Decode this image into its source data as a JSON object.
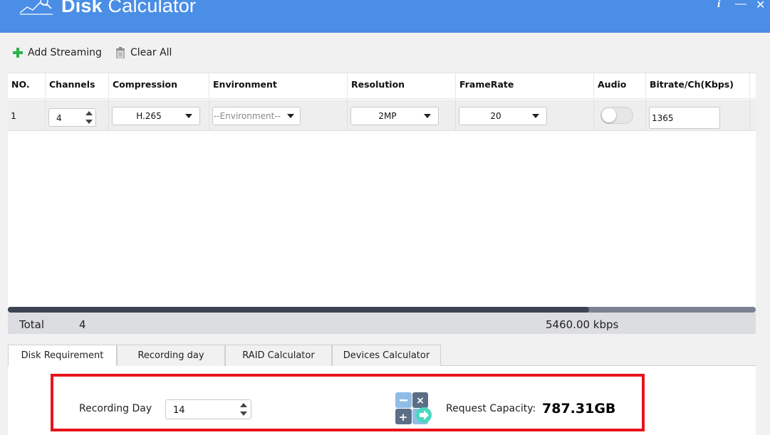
{
  "app": {
    "title_bold": "Disk",
    "title_rest": " Calculator",
    "info_icon": "i",
    "minimize_icon": "—",
    "close_icon": "✕"
  },
  "toolbar": {
    "add_label": "Add Streaming",
    "clear_label": "Clear All",
    "add_icon_color": "#2db34a"
  },
  "table": {
    "columns": [
      "NO.",
      "Channels",
      "Compression",
      "Environment",
      "Resolution",
      "FrameRate",
      "Audio",
      "Bitrate/Ch(Kbps)"
    ],
    "rows": [
      {
        "no": "1",
        "channels": "4",
        "compression": "H.265",
        "environment_placeholder": "--Environment--",
        "resolution": "2MP",
        "framerate": "20",
        "audio_on": false,
        "bitrate": "1365"
      }
    ]
  },
  "total": {
    "label": "Total",
    "channels": "4",
    "bitrate": "5460.00 kbps"
  },
  "tabs": [
    {
      "label": "Disk Requirement",
      "active": true
    },
    {
      "label": "Recording day",
      "active": false
    },
    {
      "label": "RAID Calculator",
      "active": false
    },
    {
      "label": "Devices Calculator",
      "active": false
    }
  ],
  "disk_requirement": {
    "recording_day_label": "Recording Day",
    "recording_day_value": "14",
    "capacity_label": "Request Capacity:",
    "capacity_value": "787.31GB"
  },
  "colors": {
    "titlebar": "#4a8ee6",
    "highlight_border": "#e8141b"
  }
}
